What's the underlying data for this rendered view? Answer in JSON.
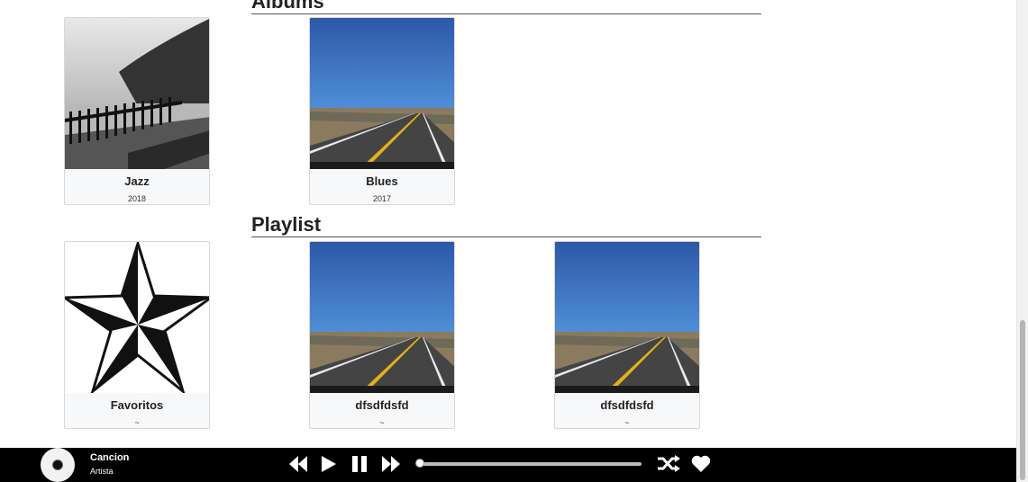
{
  "sections": {
    "albums_title": "Albums",
    "playlist_title": "Playlist"
  },
  "albums": [
    {
      "title": "Jazz",
      "year": "2018",
      "image": "black-and-white-coast-photo"
    },
    {
      "title": "Blues",
      "year": "2017",
      "image": "desert-road-photo"
    }
  ],
  "playlists": [
    {
      "title": "Favoritos",
      "subtitle": "~",
      "image": "nautical-star-image"
    },
    {
      "title": "dfsdfdsfd",
      "subtitle": "~",
      "image": "desert-road-photo"
    },
    {
      "title": "dfsdfdsfd",
      "subtitle": "~",
      "image": "desert-road-photo"
    }
  ],
  "player": {
    "song": "Cancion",
    "artist": "Artista",
    "progress": 0.0,
    "icons": [
      "rewind-icon",
      "play-icon",
      "pause-icon",
      "fast-forward-icon",
      "shuffle-icon",
      "heart-icon"
    ]
  }
}
